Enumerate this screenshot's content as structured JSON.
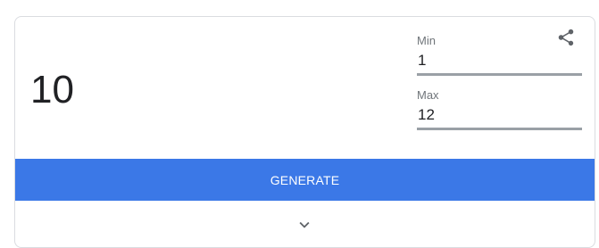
{
  "result": {
    "value": "10"
  },
  "inputs": {
    "min": {
      "label": "Min",
      "value": "1"
    },
    "max": {
      "label": "Max",
      "value": "12"
    }
  },
  "actions": {
    "generate_label": "GENERATE",
    "share_icon": "share-icon",
    "expand_icon": "chevron-down-icon"
  },
  "colors": {
    "button": "#3b78e7",
    "icon": "#5f6368"
  }
}
